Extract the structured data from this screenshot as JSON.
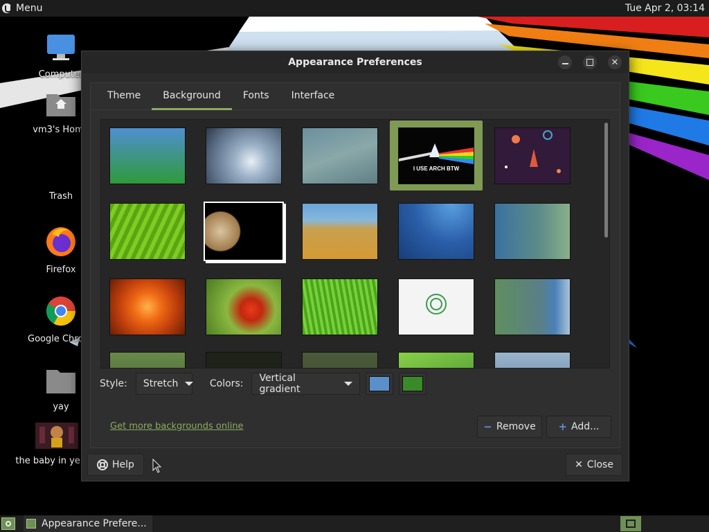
{
  "topbar": {
    "menu_label": "Menu",
    "clock": "Tue Apr  2, 03:14"
  },
  "desktop_icons": [
    {
      "label": "Computer",
      "icon": "monitor-icon"
    },
    {
      "label": "vm3's Home",
      "icon": "home-folder-icon"
    },
    {
      "label": "Trash",
      "icon": "trash-icon"
    },
    {
      "label": "Firefox",
      "icon": "firefox-icon"
    },
    {
      "label": "Google Chrome",
      "icon": "chrome-icon"
    },
    {
      "label": "yay",
      "icon": "folder-icon"
    },
    {
      "label": "the baby in yellow",
      "icon": "image-thumbnail-icon"
    }
  ],
  "window": {
    "title": "Appearance Preferences",
    "tabs": [
      "Theme",
      "Background",
      "Fonts",
      "Interface"
    ],
    "active_tab": "Background",
    "selected_wallpaper_text": "I USE ARCH BTW",
    "style_label": "Style:",
    "style_value": "Stretch",
    "colors_label": "Colors:",
    "colors_value": "Vertical gradient",
    "primary_color": "#5b8fc9",
    "secondary_color": "#3a8a2a",
    "more_link": "Get more backgrounds online",
    "remove_label": "Remove",
    "add_label": "Add...",
    "help_label": "Help",
    "close_label": "Close"
  },
  "taskbar": {
    "app_label": "Appearance Prefere..."
  }
}
